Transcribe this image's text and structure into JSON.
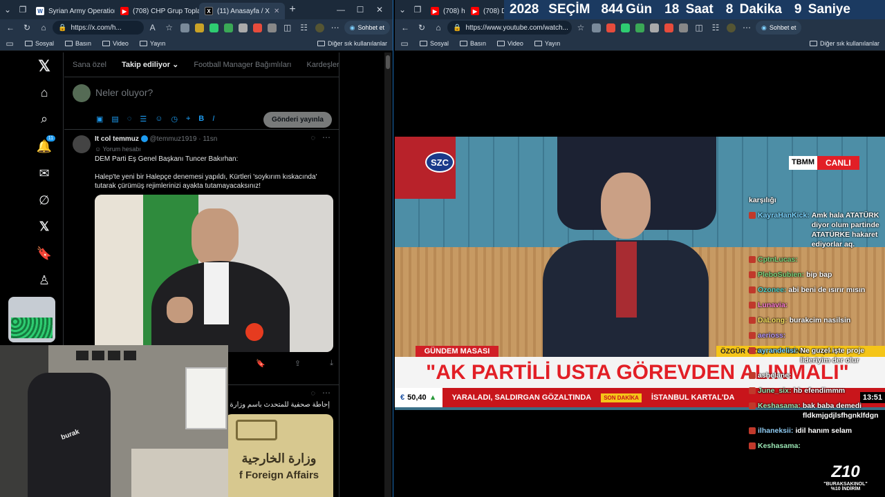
{
  "left_window": {
    "tabs": [
      {
        "label": "Syrian Army Operations",
        "icon": "doc"
      },
      {
        "label": "(708) CHP Grup Toplantı",
        "icon": "yt"
      },
      {
        "label": "(11) Anasayfa / X",
        "icon": "x",
        "active": true
      }
    ],
    "url": "https://x.com/h...",
    "copilot": "Sohbet et",
    "bookmarks": [
      "Sosyal",
      "Basın",
      "Video",
      "Yayın"
    ],
    "bookmarks_other": "Diğer sık kullanılanlar"
  },
  "x": {
    "nav": [
      {
        "name": "x-logo-icon",
        "glyph": "𝕏"
      },
      {
        "name": "home-icon",
        "glyph": "⌂"
      },
      {
        "name": "search-icon",
        "glyph": "⌕"
      },
      {
        "name": "notifications-icon",
        "glyph": "🔔",
        "badge": "11"
      },
      {
        "name": "messages-icon",
        "glyph": "✉"
      },
      {
        "name": "grok-icon",
        "glyph": "∅"
      },
      {
        "name": "premium-icon",
        "glyph": "𝕏"
      },
      {
        "name": "bookmarks-icon",
        "glyph": "🔖"
      },
      {
        "name": "profile-icon",
        "glyph": "♙"
      }
    ],
    "feed_tabs": [
      "Sana özel",
      "Takip ediliyor",
      "Football Manager Bağımlıları",
      "Kardeşler Kıra"
    ],
    "active_tab": "Takip ediliyor",
    "compose_placeholder": "Neler oluyor?",
    "post_button": "Gönderi yayınla",
    "tweet": {
      "name": "It col temmuz",
      "handle": "@temmuz1919",
      "time": "11sn",
      "sub": "Yorum hesabı",
      "line1": "DEM Parti Eş Genel Başkanı Tuncer Bakırhan:",
      "line2": "Halep'te yeni bir Halepçe denemesi yapıldı, Kürtleri 'soykırım kıskacında' tutarak çürümüş rejimlerinizi ayakta tutamayacaksınız!"
    },
    "tweet2": {
      "text": "إحاطة صحفية للمتحدث باسم وزارة الخ",
      "photo_text_ar": "وزارة الخارجية",
      "photo_text_en": "f Foreign Affairs"
    }
  },
  "right_window": {
    "tabs": [
      "(708) h",
      "(708) D"
    ],
    "url": "https://www.youtube.com/watch...",
    "copilot": "Sohbet et",
    "bookmarks": [
      "Sosyal",
      "Basın",
      "Video",
      "Yayın"
    ],
    "bookmarks_other": "Diğer sık kullanılanlar",
    "countdown": {
      "year": "2028",
      "label": "SEÇİM",
      "days": "844",
      "days_label": "Gün",
      "hours": "18",
      "hours_label": "Saat",
      "minutes": "8",
      "minutes_label": "Dakika",
      "seconds": "9",
      "seconds_label": "Saniye"
    }
  },
  "broadcast": {
    "channel": "SZC",
    "source": "TBMM",
    "live": "CANLI",
    "program": "GÜNDEM MASASI",
    "subtitle": "ÖZGÜR ÖZEL, CHP GENEL BAŞKANI",
    "headline": "\"AK PARTİLİ USTA GÖREVDEN ALINMALI\"",
    "ticker_value": "50,40",
    "ticker_text": "YARALADI, SALDIRGAN GÖZALTINDA",
    "ticker_tag": "SON DAKİKA",
    "ticker_text2": "İSTANBUL KARTAL'DA",
    "clock": "13:51"
  },
  "chat": [
    {
      "user": "",
      "msg": "karşılığı",
      "color": "#ffffff"
    },
    {
      "user": "KayraHanKick:",
      "msg": "Amk hala ATATÜRK diyor olum partinde ATATÜRKE hakaret ediyorlar aq.",
      "color": "#7bd4ff"
    },
    {
      "user": "CptnLucas:",
      "msg": "",
      "color": "#7bd47b"
    },
    {
      "user": "PleboSubien:",
      "msg": "bip bap",
      "color": "#7bd47b"
    },
    {
      "user": "Ozonee:",
      "msg": "abi beni de ısırır mısın",
      "color": "#4fd1c5"
    },
    {
      "user": "Lunavia:",
      "msg": "",
      "color": "#ff7bd0"
    },
    {
      "user": "DaLong:",
      "msg": "burakcim nasilsin",
      "color": "#f6e05e"
    },
    {
      "user": "aerioss:",
      "msg": "",
      "color": "#b794f4"
    },
    {
      "user": "ayrandelisi:",
      "msg": "Ne guzel işte proje lideriyim der olur",
      "color": "#7bd4ff"
    },
    {
      "user": "ashelane:",
      "msg": "",
      "color": "#ffffff"
    },
    {
      "user": "June_six:",
      "msg": "hb efendimmm",
      "color": "#9ae6b4"
    },
    {
      "user": "Keshasama:",
      "msg": "bak baba demedi fldkmjgdjlsfhgnklfdgn",
      "color": "#9ae6b4"
    },
    {
      "user": "ilhaneksii:",
      "msg": "idil hanım selam",
      "color": "#90cdf4"
    },
    {
      "user": "Keshasama:",
      "msg": "",
      "color": "#9ae6b4"
    }
  ],
  "overlay": {
    "logo": "Z10",
    "code": "\"BURAKSAKINOL\"",
    "discount": "%10 İNDİRİM"
  },
  "colors": {
    "x_blue": "#1d9bf0",
    "yt_red": "#ff0000",
    "banner": "#1b3a61",
    "headline_red": "#e21f26"
  }
}
